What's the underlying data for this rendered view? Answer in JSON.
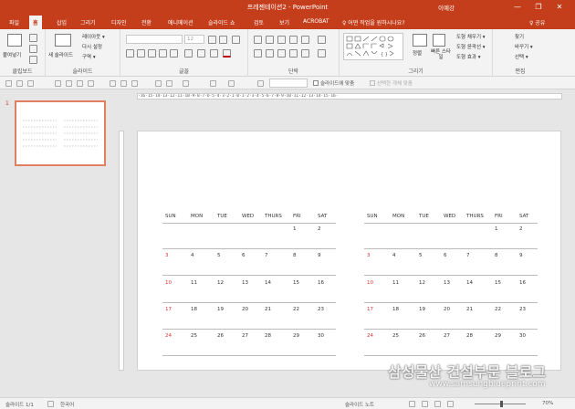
{
  "window": {
    "title": "프레젠테이션2 - PowerPoint",
    "user": "이예강",
    "minimize": "—",
    "restore": "❐",
    "close": "✕"
  },
  "tabs": [
    "파일",
    "홈",
    "삽입",
    "그리기",
    "디자인",
    "전환",
    "애니메이션",
    "슬라이드 쇼",
    "검토",
    "보기",
    "ACROBAT"
  ],
  "active_tab": "홈",
  "tell_me": "♀ 어떤 작업을 원하시나요?",
  "share": "♀ 공유",
  "ribbon": {
    "clipboard": {
      "label": "클립보드",
      "paste": "붙여넣기"
    },
    "slides": {
      "label": "슬라이드",
      "new_slide": "새 슬라이드",
      "layout": "레이아웃 ▾",
      "reset": "다시 설정",
      "section": "구역 ▾"
    },
    "font": {
      "label": "글꼴",
      "font_size": "12"
    },
    "paragraph": {
      "label": "단락"
    },
    "drawing": {
      "label": "그리기",
      "arrange": "정렬",
      "quick_styles": "빠른 스타일",
      "fill": "도형 채우기 ▾",
      "outline": "도형 윤곽선 ▾",
      "effects": "도형 효과 ▾"
    },
    "editing": {
      "label": "편집",
      "find": "찾기",
      "replace": "바꾸기 ▾",
      "select": "선택 ▾"
    }
  },
  "quick_toolbar": {
    "slide_fit": "슬라이드에 맞춤",
    "selected_only": "선택한 개체 맞춤"
  },
  "slide_number": "1",
  "ruler_text": "·16·15·14·13·12·11·10·9·8·7·6·5·4·3·2·1·0·1·2·3·4·5·6·7·8·9·10·11·12·13·14·15·16·",
  "calendars": [
    {
      "weekdays": [
        "SUN",
        "MON",
        "TUE",
        "WED",
        "THURS",
        "FRI",
        "SAT"
      ],
      "weeks": [
        [
          "",
          "",
          "",
          "",
          "",
          "1",
          "2"
        ],
        [
          "3",
          "4",
          "5",
          "6",
          "7",
          "8",
          "9"
        ],
        [
          "10",
          "11",
          "12",
          "13",
          "14",
          "15",
          "16"
        ],
        [
          "17",
          "18",
          "19",
          "20",
          "21",
          "22",
          "23"
        ],
        [
          "24",
          "25",
          "26",
          "27",
          "28",
          "29",
          "30"
        ]
      ]
    },
    {
      "weekdays": [
        "SUN",
        "MON",
        "TUE",
        "WED",
        "THURS",
        "FRI",
        "SAT"
      ],
      "weeks": [
        [
          "",
          "",
          "",
          "",
          "",
          "1",
          "2"
        ],
        [
          "3",
          "4",
          "5",
          "6",
          "7",
          "8",
          "9"
        ],
        [
          "10",
          "11",
          "12",
          "13",
          "14",
          "15",
          "16"
        ],
        [
          "17",
          "18",
          "19",
          "20",
          "21",
          "22",
          "23"
        ],
        [
          "24",
          "25",
          "26",
          "27",
          "28",
          "29",
          "30"
        ]
      ]
    }
  ],
  "status": {
    "slide": "슬라이드 1/1",
    "language": "한국어",
    "notes": "슬라이드 노트",
    "zoom": "70%"
  },
  "watermark": {
    "line1": "삼성물산 건설부문 블로그",
    "line2": "www.samsungblueprint.com"
  },
  "colors": {
    "accent": "#c43e1c",
    "sunday": "#e03030"
  }
}
